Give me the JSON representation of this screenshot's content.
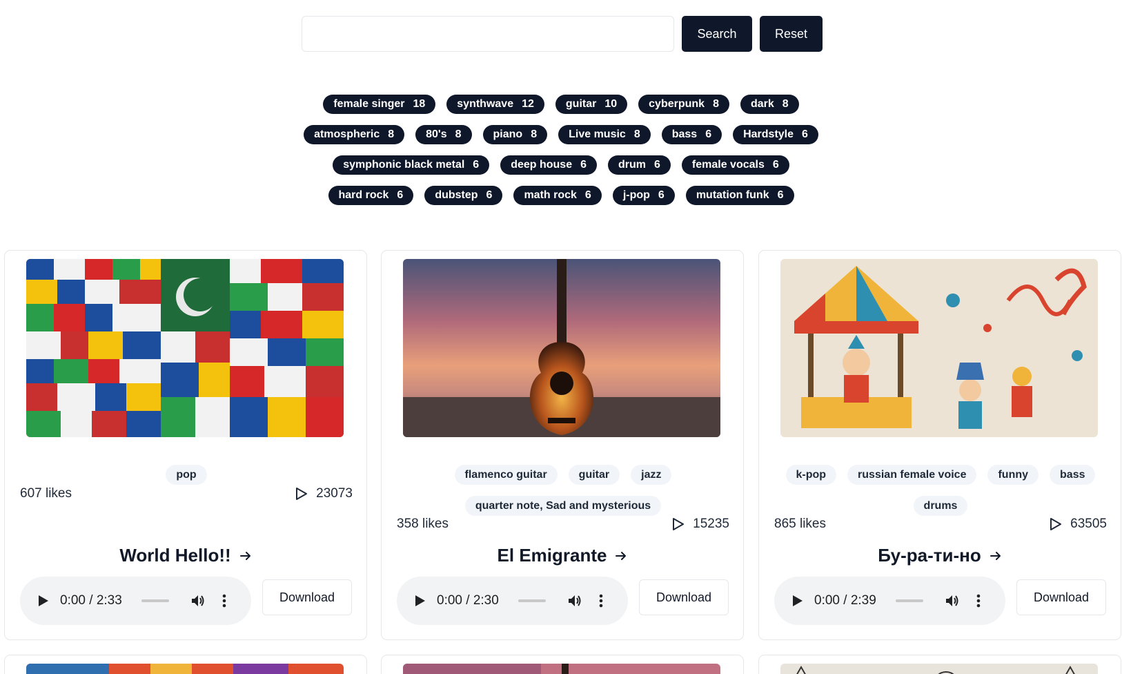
{
  "search": {
    "value": "",
    "button": "Search",
    "reset": "Reset"
  },
  "tag_rows": [
    [
      {
        "name": "female singer",
        "count": "18"
      },
      {
        "name": "synthwave",
        "count": "12"
      },
      {
        "name": "guitar",
        "count": "10"
      },
      {
        "name": "cyberpunk",
        "count": "8"
      },
      {
        "name": "dark",
        "count": "8"
      }
    ],
    [
      {
        "name": "atmospheric",
        "count": "8"
      },
      {
        "name": "80's",
        "count": "8"
      },
      {
        "name": "piano",
        "count": "8"
      },
      {
        "name": "Live music",
        "count": "8"
      },
      {
        "name": "bass",
        "count": "6"
      },
      {
        "name": "Hardstyle",
        "count": "6"
      }
    ],
    [
      {
        "name": "symphonic black metal",
        "count": "6"
      },
      {
        "name": "deep house",
        "count": "6"
      },
      {
        "name": "drum",
        "count": "6"
      },
      {
        "name": "female vocals",
        "count": "6"
      }
    ],
    [
      {
        "name": "hard rock",
        "count": "6"
      },
      {
        "name": "dubstep",
        "count": "6"
      },
      {
        "name": "math rock",
        "count": "6"
      },
      {
        "name": "j-pop",
        "count": "6"
      },
      {
        "name": "mutation funk",
        "count": "6"
      }
    ]
  ],
  "songs": [
    {
      "title": "World Hello!!",
      "tags": [
        "pop"
      ],
      "likes": "607 likes",
      "plays": "23073",
      "time": "0:00 / 2:33",
      "download": "Download",
      "image": "flags-collage"
    },
    {
      "title": "El Emigrante",
      "tags": [
        "flamenco guitar",
        "guitar",
        "jazz",
        "quarter note,  Sad and mysterious"
      ],
      "likes": "358 likes",
      "plays": "15235",
      "time": "0:00 / 2:30",
      "download": "Download",
      "image": "guitar-sunset"
    },
    {
      "title": "Бу-ра-ти-но",
      "tags": [
        "k-pop",
        "russian female voice",
        "funny",
        "bass",
        "drums"
      ],
      "likes": "865 likes",
      "plays": "63505",
      "time": "0:00 / 2:39",
      "download": "Download",
      "image": "carnival-illustration"
    }
  ],
  "icons": {
    "play": "play-icon",
    "plays": "play-outline-icon",
    "arrow": "arrow-right-icon",
    "volume": "volume-icon",
    "more": "more-vert-icon"
  },
  "colors": {
    "primary": "#0f172a",
    "tag_bg": "#f1f5f9",
    "player_bg": "#f1f3f4",
    "border": "#e5e7eb"
  }
}
